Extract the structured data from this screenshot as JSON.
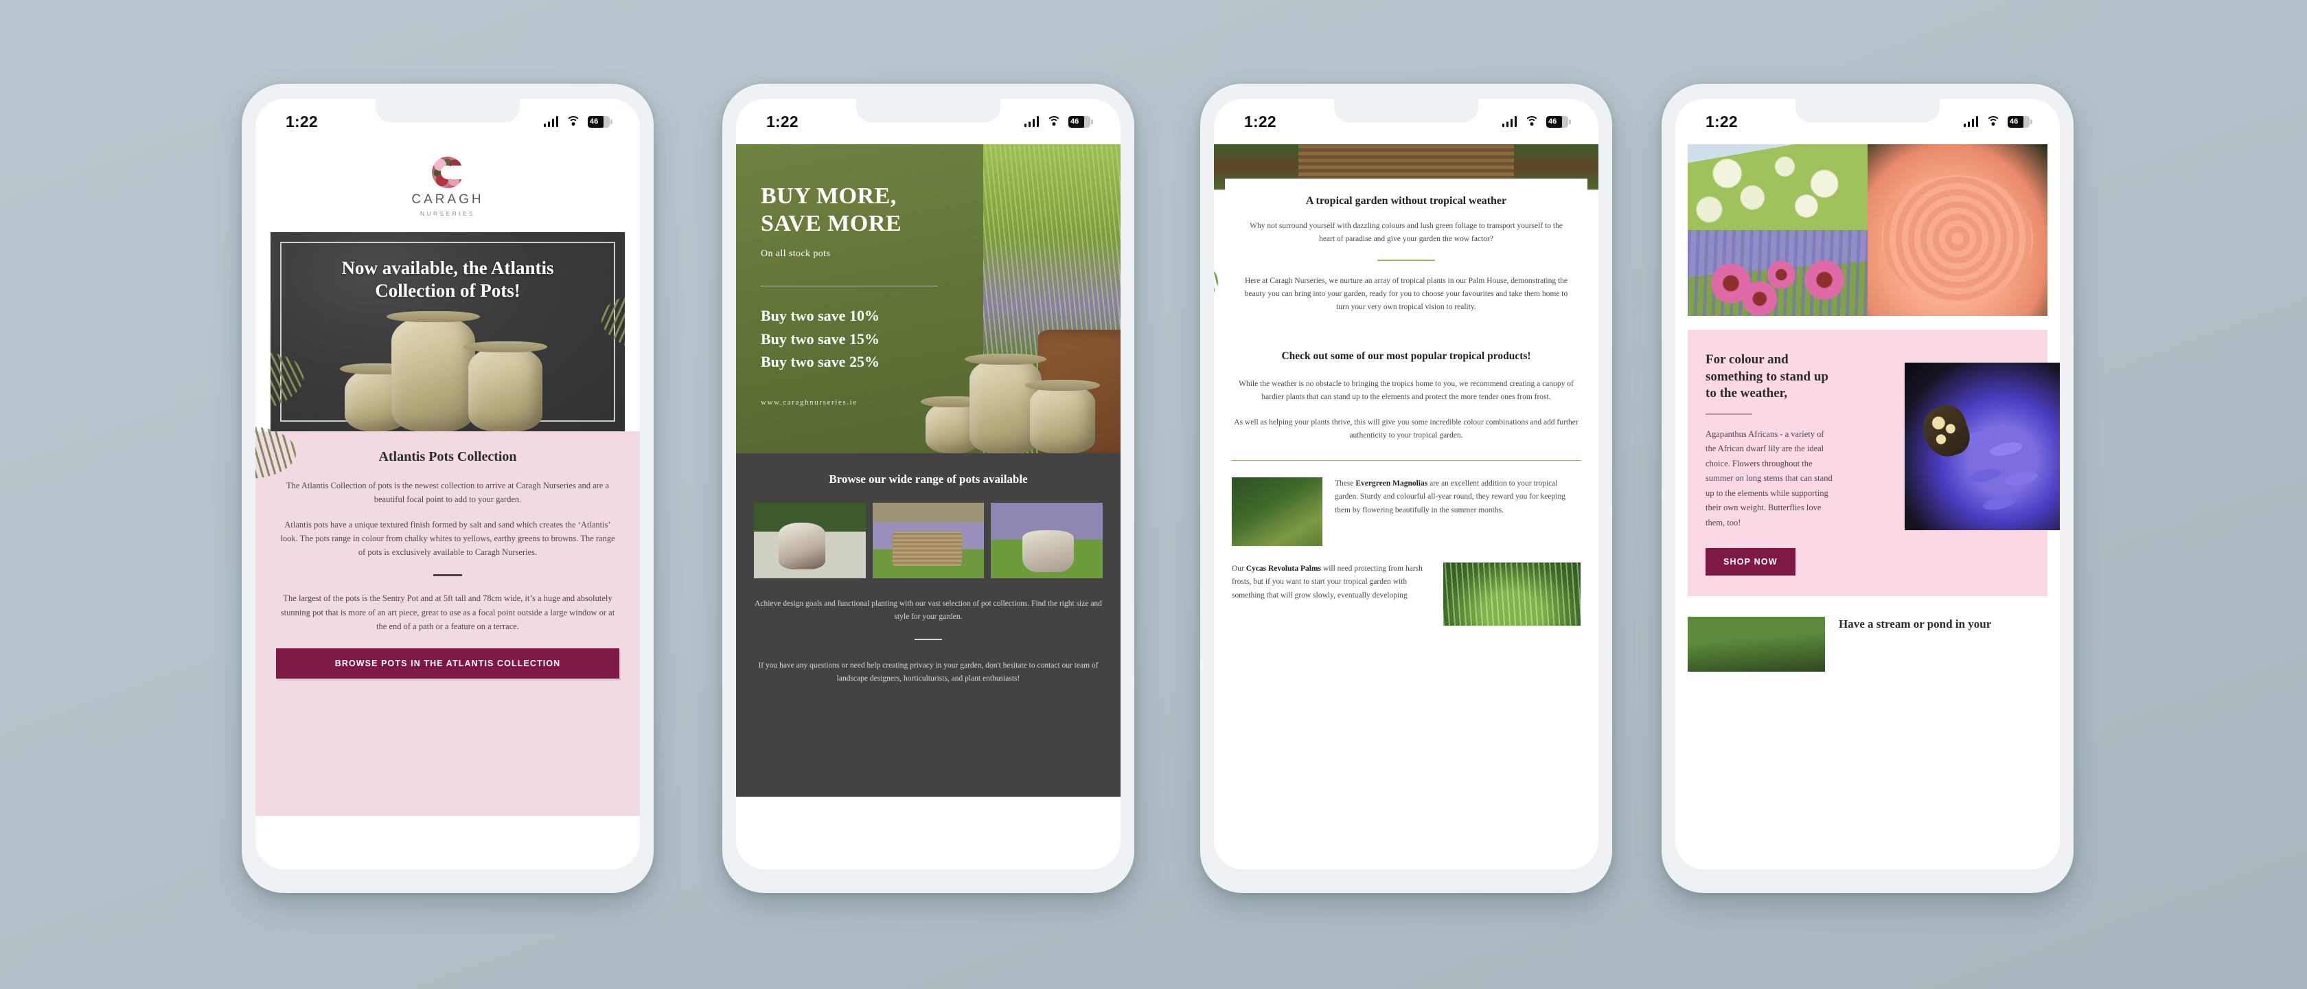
{
  "statusbar": {
    "time": "1:22",
    "battery": "46"
  },
  "brand": {
    "name": "CARAGH",
    "sub": "NURSERIES"
  },
  "phone1": {
    "hero_title": "Now available, the Atlantis Collection of Pots!",
    "section_title": "Atlantis Pots Collection",
    "paragraph1": "The Atlantis Collection of pots is the newest collection to arrive at Caragh Nurseries and are a beautiful focal point to add to your garden.",
    "paragraph2": "Atlantis pots have a unique textured finish formed by salt and sand which creates the ‘Atlantis’ look. The pots range in colour from chalky whites to yellows, earthy greens to browns. The range of pots is exclusively available to Caragh Nurseries.",
    "paragraph3": "The largest of the pots is the Sentry Pot and at 5ft tall and 78cm wide, it’s a huge and absolutely stunning pot that is more of an art piece, great to use as a focal point outside a large window or at the end of a path or a feature on a terrace.",
    "cta": "BROWSE POTS IN THE ATLANTIS COLLECTION"
  },
  "phone2": {
    "headline_line1": "BUY MORE,",
    "headline_line2": "SAVE MORE",
    "subheadline": "On all stock pots",
    "offers": [
      "Buy two save 10%",
      "Buy two save 15%",
      "Buy two save 25%"
    ],
    "url": "www.caraghnurseries.ie",
    "browse_title": "Browse our wide range of pots available",
    "note1": "Achieve design goals and functional planting with our vast selection of pot collections. Find the right size and style for your garden.",
    "note2": "If you have any questions or need help creating privacy in your garden, don't hesitate to contact our team of landscape designers, horticulturists, and plant enthusiasts!"
  },
  "phone3": {
    "card_title": "A tropical garden without tropical weather",
    "card_p1": "Why not surround yourself with dazzling colours and lush green foliage to transport yourself to the heart of paradise and give your garden the wow factor?",
    "card_p2": "Here at Caragh Nurseries, we nurture an array of tropical plants in our Palm House, demonstrating the beauty you can bring into your garden, ready for you to choose your favourites and take them home to turn your very own tropical vision to reality.",
    "section_title": "Check out some of our most popular tropical products!",
    "section_p1": "While the weather is no obstacle to bringing the tropics home to you, we recommend creating a canopy of hardier plants that can stand up to the elements and protect the more tender ones from frost.",
    "section_p2": "As well as helping your plants thrive, this will give you some incredible colour combinations and add further authenticity to your tropical garden.",
    "product1_lead": "These ",
    "product1_name": "Evergreen Magnolias",
    "product1_body": " are an excellent addition to your tropical garden. Sturdy and colourful all-year round, they reward you for keeping them by flowering beautifully in the summer months.",
    "product2_lead": "Our ",
    "product2_name": "Cycas Revoluta Palms",
    "product2_body": " will need protecting from harsh frosts, but if you want to start your tropical garden with something that will grow slowly, eventually developing"
  },
  "phone4": {
    "heading": "For colour and something to stand up to the weather,",
    "body": "Agapanthus Africans - a variety of the African dwarf lily are the ideal choice. Flowers throughout the summer on long stems that can stand up to the elements while supporting their own weight. Butterflies love them, too!",
    "cta": "SHOP NOW",
    "next_heading": "Have a stream or pond in your"
  },
  "colors": {
    "maroon": "#7d1944",
    "green": "#5f7237",
    "pink": "#fad9e4",
    "lilac": "#f1dae2",
    "dark": "#434343",
    "page_bg": "#b5c2c9"
  }
}
